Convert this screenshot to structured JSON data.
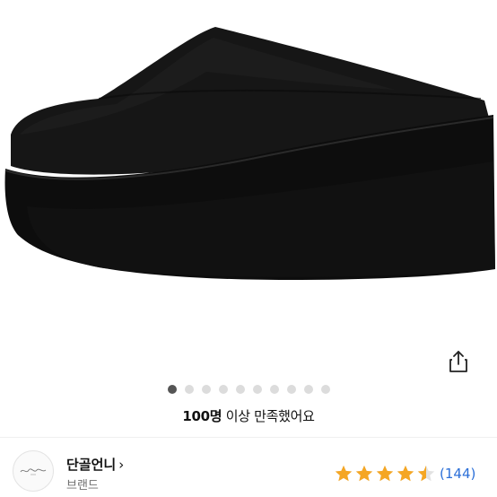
{
  "product": {
    "image_alt": "black suede wedge platform mule",
    "carousel_total": 10,
    "carousel_active_index": 0
  },
  "share": {
    "icon": "share-icon"
  },
  "satisfaction": {
    "count_text": "100명",
    "rest_text": " 이상 만족했어요"
  },
  "brand": {
    "name": "단골언니",
    "chevron": "›",
    "type_label": "브랜드",
    "logo_icon": "brand-logo-icon"
  },
  "rating": {
    "score_fraction": 0.9,
    "stars_total": 5,
    "review_count": "(144)",
    "star_color": "#f5a623"
  }
}
